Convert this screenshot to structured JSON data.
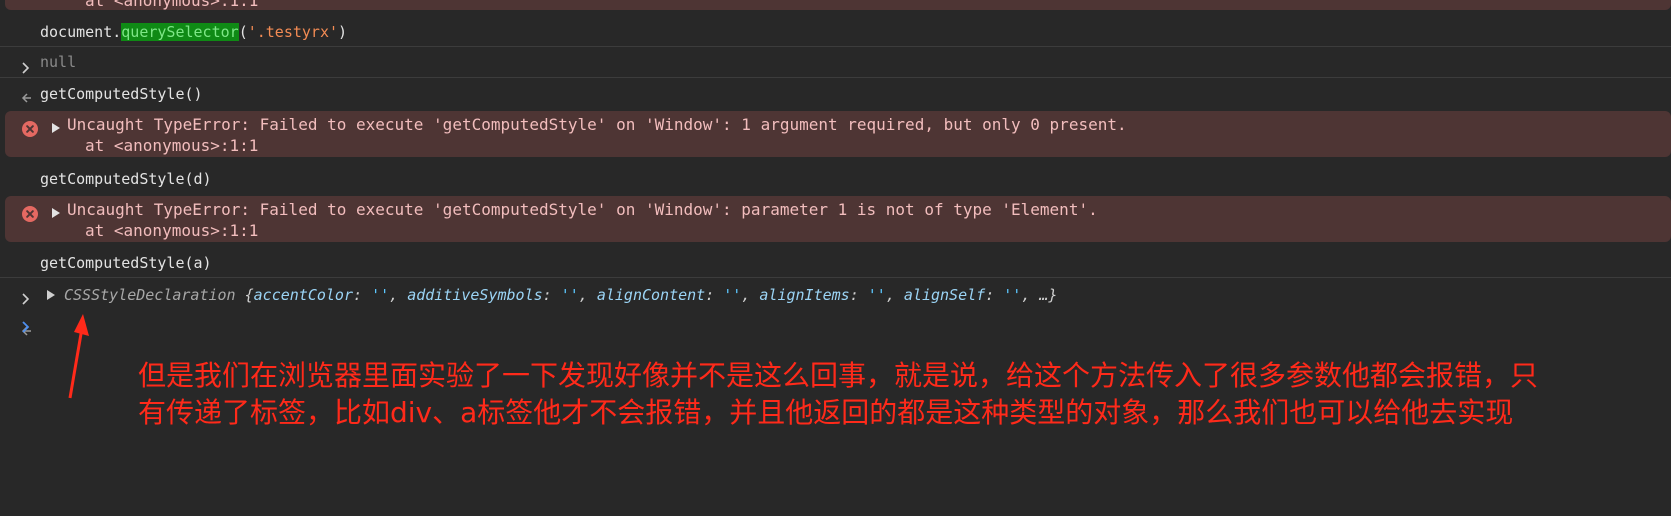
{
  "top_partial": "at <anonymous>:1:1",
  "rows": {
    "cmd1": {
      "pre": "document.",
      "hl": "querySelector",
      "post_open": "(",
      "arg": "'.testyrx'",
      "post_close": ")"
    },
    "res1": "null",
    "cmd2": "getComputedStyle()",
    "err1": {
      "message": "Uncaught TypeError: Failed to execute 'getComputedStyle' on 'Window': 1 argument required, but only 0 present.",
      "trace": "at <anonymous>:1:1"
    },
    "cmd3": "getComputedStyle(d)",
    "err2": {
      "message": "Uncaught TypeError: Failed to execute 'getComputedStyle' on 'Window': parameter 1 is not of type 'Element'.",
      "trace": "at <anonymous>:1:1"
    },
    "cmd4": "getComputedStyle(a)",
    "res4": {
      "type": "CSSStyleDeclaration",
      "open": " {",
      "props": [
        {
          "key": "accentColor",
          "val": "''"
        },
        {
          "key": "additiveSymbols",
          "val": "''"
        },
        {
          "key": "alignContent",
          "val": "''"
        },
        {
          "key": "alignItems",
          "val": "''"
        },
        {
          "key": "alignSelf",
          "val": "''"
        }
      ],
      "tail": ", …}"
    }
  },
  "annotation": "但是我们在浏览器里面实验了一下发现好像并不是这么回事，就是说，给这个方法传入了很多参数他都会报错，只有传递了标签，比如div、a标签他才不会报错，并且他返回的都是这种类型的对象，那么我们也可以给他去实现",
  "icons": {
    "input": "chevron-right-icon",
    "output": "return-arrow-icon",
    "error": "error-circle-icon",
    "expand": "expand-triangle-icon",
    "prompt": "prompt-chevron-icon"
  },
  "colors": {
    "background": "#282828",
    "error_bg": "#4e3534",
    "error_icon": "#e46962",
    "string": "#f28b54",
    "highlight": "#0f8a15",
    "annotation": "#ff2a1a"
  }
}
